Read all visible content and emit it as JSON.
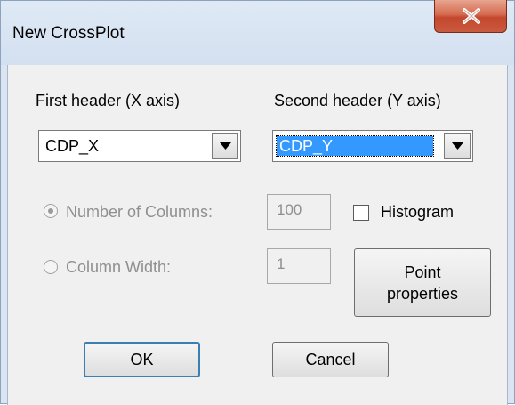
{
  "window": {
    "title": "New CrossPlot"
  },
  "labels": {
    "first_header": "First header (X axis)",
    "second_header": "Second header (Y axis)",
    "num_columns": "Number of Columns:",
    "column_width": "Column Width:",
    "histogram": "Histogram"
  },
  "combos": {
    "first_value": "CDP_X",
    "second_value": "CDP_Y"
  },
  "inputs": {
    "num_columns_value": "100",
    "column_width_value": "1"
  },
  "buttons": {
    "point_properties": "Point\nproperties",
    "ok": "OK",
    "cancel": "Cancel"
  },
  "state": {
    "num_columns_selected": true,
    "column_width_selected": false,
    "histogram_checked": false
  },
  "colors": {
    "selection": "#3399ff",
    "close_button": "#c4472c"
  },
  "icons": {
    "close": "close-x-icon",
    "dropdown": "chevron-down-icon"
  }
}
